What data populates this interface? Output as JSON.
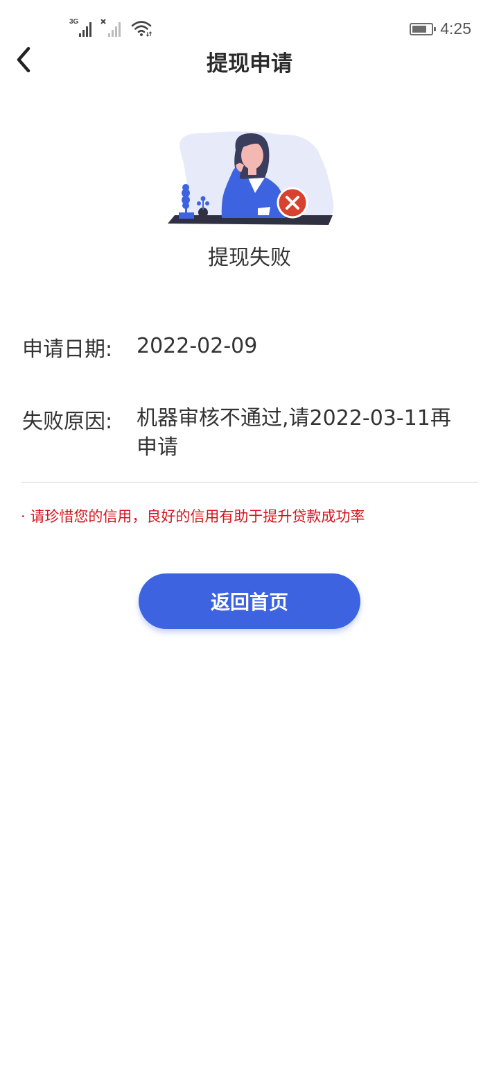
{
  "status_bar": {
    "network_label": "3G",
    "time": "4:25",
    "icons": [
      "signal-3g-icon",
      "signal-no-service-icon",
      "wifi-icon",
      "battery-icon"
    ]
  },
  "header": {
    "title": "提现申请",
    "back_icon": "chevron-left-icon"
  },
  "result": {
    "illustration": "woman-thinking-with-error-icon",
    "status_text": "提现失败",
    "error_color": "#d9412f"
  },
  "info": {
    "date_label": "申请日期:",
    "date_value": "2022-02-09",
    "reason_label": "失败原因:",
    "reason_value": "机器审核不通过,请2022-03-11再申请"
  },
  "tip": "· 请珍惜您的信用，良好的信用有助于提升贷款成功率",
  "colors": {
    "accent": "#3d63e1",
    "tip": "#d6121c"
  },
  "home_button": {
    "label": "返回首页"
  }
}
